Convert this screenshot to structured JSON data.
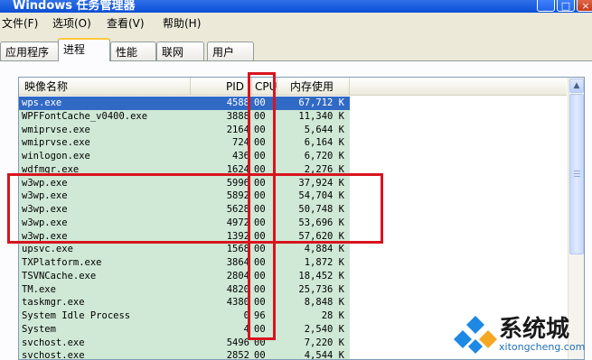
{
  "window": {
    "title": "Windows 任务管理器",
    "min": "_",
    "max": "□"
  },
  "menu": [
    "文件(F)",
    "选项(O)",
    "查看(V)",
    "帮助(H)"
  ],
  "tabs": [
    "应用程序",
    "进程",
    "性能",
    "联网",
    "用户"
  ],
  "columns": {
    "name": "映像名称",
    "pid": "PID",
    "cpu": "CPU",
    "mem": "内存使用"
  },
  "processes": [
    {
      "name": "wps.exe",
      "pid": "4588",
      "cpu": "00",
      "mem": "67,712 K"
    },
    {
      "name": "WPFFontCache_v0400.exe",
      "pid": "3888",
      "cpu": "00",
      "mem": "11,340 K"
    },
    {
      "name": "wmiprvse.exe",
      "pid": "2164",
      "cpu": "00",
      "mem": "5,644 K"
    },
    {
      "name": "wmiprvse.exe",
      "pid": "724",
      "cpu": "00",
      "mem": "6,164 K"
    },
    {
      "name": "winlogon.exe",
      "pid": "436",
      "cpu": "00",
      "mem": "6,720 K"
    },
    {
      "name": "wdfmgr.exe",
      "pid": "1624",
      "cpu": "00",
      "mem": "2,276 K"
    },
    {
      "name": "w3wp.exe",
      "pid": "5996",
      "cpu": "00",
      "mem": "37,924 K"
    },
    {
      "name": "w3wp.exe",
      "pid": "5892",
      "cpu": "00",
      "mem": "54,704 K"
    },
    {
      "name": "w3wp.exe",
      "pid": "5628",
      "cpu": "00",
      "mem": "50,748 K"
    },
    {
      "name": "w3wp.exe",
      "pid": "4972",
      "cpu": "00",
      "mem": "53,696 K"
    },
    {
      "name": "w3wp.exe",
      "pid": "1392",
      "cpu": "00",
      "mem": "57,620 K"
    },
    {
      "name": "upsvc.exe",
      "pid": "1568",
      "cpu": "00",
      "mem": "4,884 K"
    },
    {
      "name": "TXPlatform.exe",
      "pid": "3864",
      "cpu": "00",
      "mem": "1,872 K"
    },
    {
      "name": "TSVNCache.exe",
      "pid": "2804",
      "cpu": "00",
      "mem": "18,452 K"
    },
    {
      "name": "TM.exe",
      "pid": "4820",
      "cpu": "00",
      "mem": "25,736 K"
    },
    {
      "name": "taskmgr.exe",
      "pid": "4380",
      "cpu": "00",
      "mem": "8,848 K"
    },
    {
      "name": "System Idle Process",
      "pid": "0",
      "cpu": "96",
      "mem": "28 K"
    },
    {
      "name": "System",
      "pid": "4",
      "cpu": "00",
      "mem": "2,540 K"
    },
    {
      "name": "svchost.exe",
      "pid": "5496",
      "cpu": "00",
      "mem": "7,220 K"
    },
    {
      "name": "svchost.exe",
      "pid": "2852",
      "cpu": "00",
      "mem": "4,544 K"
    }
  ],
  "selected_process": "wps.exe",
  "watermark": {
    "brand": "系统城",
    "url": "xitongcheng.com"
  },
  "colors": {
    "highlight_box": "#d8141e",
    "selection": "#316ac5",
    "row_tint": "#cfe9d6"
  }
}
